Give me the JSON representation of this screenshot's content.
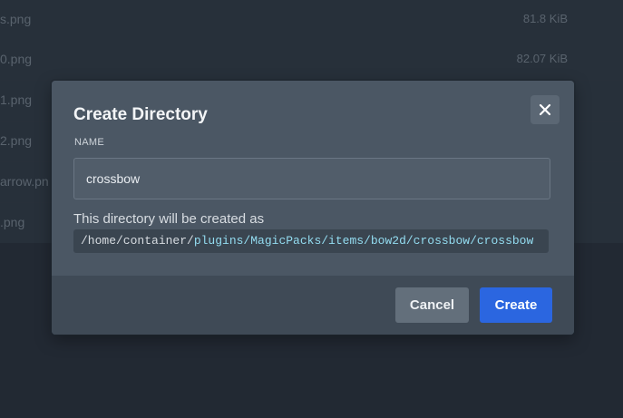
{
  "files": [
    {
      "name": "s.png",
      "size": "81.8 KiB"
    },
    {
      "name": "0.png",
      "size": "82.07 KiB"
    },
    {
      "name": "1.png",
      "size": ""
    },
    {
      "name": "2.png",
      "size": ""
    },
    {
      "name": "arrow.pn",
      "size": ""
    },
    {
      "name": ".png",
      "size": ""
    }
  ],
  "modal": {
    "title": "Create Directory",
    "close_icon": "close-icon",
    "field_label": "NAME",
    "input_value": "crossbow",
    "help_text": "This directory will be created as",
    "path_base": "/home/container/",
    "path_relative": "plugins/MagicPacks/items/bow2d/crossbow/crossbow",
    "cancel_label": "Cancel",
    "create_label": "Create"
  },
  "colors": {
    "primary": "#2b66e0",
    "path_highlight": "#93dcf0"
  }
}
